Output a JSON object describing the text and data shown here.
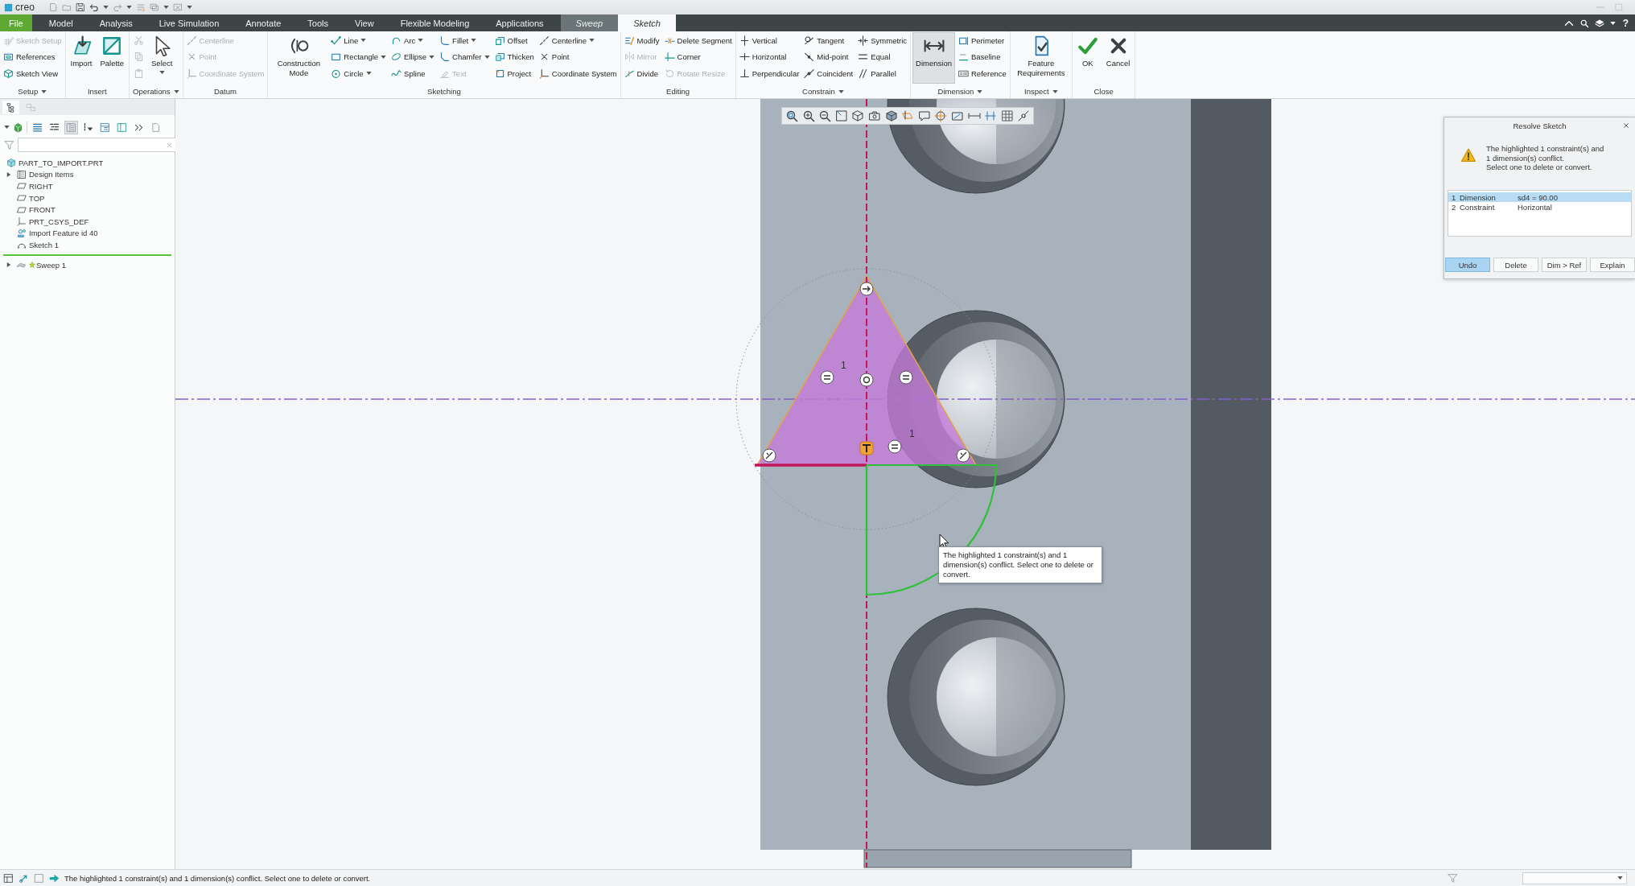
{
  "title_bar": {
    "logo": "creo"
  },
  "menu_tabs": [
    {
      "label": "File",
      "kind": "file",
      "selected": false
    },
    {
      "label": "Model",
      "kind": "main",
      "selected": false
    },
    {
      "label": "Analysis",
      "kind": "main",
      "selected": false
    },
    {
      "label": "Live Simulation",
      "kind": "main",
      "selected": false
    },
    {
      "label": "Annotate",
      "kind": "main",
      "selected": false
    },
    {
      "label": "Tools",
      "kind": "main",
      "selected": false
    },
    {
      "label": "View",
      "kind": "main",
      "selected": false
    },
    {
      "label": "Flexible Modeling",
      "kind": "main",
      "selected": false
    },
    {
      "label": "Applications",
      "kind": "main",
      "selected": false
    },
    {
      "label": "Sweep",
      "kind": "context",
      "selected": false
    },
    {
      "label": "Sketch",
      "kind": "context",
      "selected": true
    }
  ],
  "help": "?",
  "ribbon": [
    {
      "label": "Setup",
      "menu": true,
      "columns": [
        {
          "kind": "stack",
          "items": [
            {
              "label": "Sketch Setup",
              "disabled": true,
              "dropdown": false
            },
            {
              "label": "References",
              "disabled": false,
              "dropdown": false
            },
            {
              "label": "Sketch View",
              "disabled": false,
              "dropdown": false
            }
          ]
        }
      ]
    },
    {
      "label": "Insert",
      "menu": false,
      "columns": [
        {
          "kind": "large",
          "label": "Import",
          "selected": false,
          "dropdown": false
        },
        {
          "kind": "large",
          "label": "Palette",
          "selected": false,
          "dropdown": false
        }
      ]
    },
    {
      "label": "Operations",
      "menu": true,
      "columns": [
        {
          "kind": "icons",
          "items": [
            {
              "disabled": true
            },
            {
              "disabled": true
            },
            {
              "disabled": true
            }
          ]
        },
        {
          "kind": "large",
          "label": "Select",
          "selected": false,
          "dropdown": true
        }
      ]
    },
    {
      "label": "Datum",
      "menu": false,
      "columns": [
        {
          "kind": "stack",
          "items": [
            {
              "label": "Centerline",
              "disabled": true,
              "dropdown": false
            },
            {
              "label": "Point",
              "disabled": true,
              "dropdown": false
            },
            {
              "label": "Coordinate System",
              "disabled": true,
              "dropdown": false
            }
          ]
        }
      ]
    },
    {
      "label": "Sketching",
      "menu": false,
      "columns": [
        {
          "kind": "large",
          "label": "Construction Mode",
          "selected": false,
          "dropdown": false
        },
        {
          "kind": "stack",
          "items": [
            {
              "label": "Line",
              "disabled": false,
              "dropdown": true
            },
            {
              "label": "Rectangle",
              "disabled": false,
              "dropdown": true
            },
            {
              "label": "Circle",
              "disabled": false,
              "dropdown": true
            }
          ]
        },
        {
          "kind": "stack",
          "items": [
            {
              "label": "Arc",
              "disabled": false,
              "dropdown": true
            },
            {
              "label": "Ellipse",
              "disabled": false,
              "dropdown": true
            },
            {
              "label": "Spline",
              "disabled": false,
              "dropdown": false
            }
          ]
        },
        {
          "kind": "stack",
          "items": [
            {
              "label": "Fillet",
              "disabled": false,
              "dropdown": true
            },
            {
              "label": "Chamfer",
              "disabled": false,
              "dropdown": true
            },
            {
              "label": "Text",
              "disabled": true,
              "dropdown": false
            }
          ]
        },
        {
          "kind": "stack",
          "items": [
            {
              "label": "Offset",
              "disabled": false,
              "dropdown": false
            },
            {
              "label": "Thicken",
              "disabled": false,
              "dropdown": false
            },
            {
              "label": "Project",
              "disabled": false,
              "dropdown": false
            }
          ]
        },
        {
          "kind": "stack",
          "items": [
            {
              "label": "Centerline",
              "disabled": false,
              "dropdown": true
            },
            {
              "label": "Point",
              "disabled": false,
              "dropdown": false
            },
            {
              "label": "Coordinate System",
              "disabled": false,
              "dropdown": false
            }
          ]
        }
      ]
    },
    {
      "label": "Editing",
      "menu": false,
      "columns": [
        {
          "kind": "stack",
          "items": [
            {
              "label": "Modify",
              "disabled": false,
              "dropdown": false
            },
            {
              "label": "Mirror",
              "disabled": true,
              "dropdown": false
            },
            {
              "label": "Divide",
              "disabled": false,
              "dropdown": false
            }
          ]
        },
        {
          "kind": "stack",
          "items": [
            {
              "label": "Delete Segment",
              "disabled": false,
              "dropdown": false
            },
            {
              "label": "Corner",
              "disabled": false,
              "dropdown": false
            },
            {
              "label": "Rotate Resize",
              "disabled": true,
              "dropdown": false
            }
          ]
        }
      ]
    },
    {
      "label": "Constrain",
      "menu": true,
      "columns": [
        {
          "kind": "stack",
          "items": [
            {
              "label": "Vertical",
              "disabled": false,
              "dropdown": false
            },
            {
              "label": "Horizontal",
              "disabled": false,
              "dropdown": false
            },
            {
              "label": "Perpendicular",
              "disabled": false,
              "dropdown": false
            }
          ]
        },
        {
          "kind": "stack",
          "items": [
            {
              "label": "Tangent",
              "disabled": false,
              "dropdown": false
            },
            {
              "label": "Mid-point",
              "disabled": false,
              "dropdown": false
            },
            {
              "label": "Coincident",
              "disabled": false,
              "dropdown": false
            }
          ]
        },
        {
          "kind": "stack",
          "items": [
            {
              "label": "Symmetric",
              "disabled": false,
              "dropdown": false
            },
            {
              "label": "Equal",
              "disabled": false,
              "dropdown": false
            },
            {
              "label": "Parallel",
              "disabled": false,
              "dropdown": false
            }
          ]
        }
      ]
    },
    {
      "label": "Dimension",
      "menu": true,
      "columns": [
        {
          "kind": "large",
          "label": "Dimension",
          "selected": true,
          "dropdown": false
        },
        {
          "kind": "stack",
          "items": [
            {
              "label": "Perimeter",
              "disabled": false,
              "dropdown": false
            },
            {
              "label": "Baseline",
              "disabled": false,
              "dropdown": false
            },
            {
              "label": "Reference",
              "disabled": false,
              "dropdown": false
            }
          ]
        }
      ]
    },
    {
      "label": "Inspect",
      "menu": true,
      "columns": [
        {
          "kind": "large",
          "label": "Feature Requirements",
          "selected": false,
          "dropdown": false
        }
      ]
    },
    {
      "label": "Close",
      "menu": false,
      "columns": [
        {
          "kind": "large",
          "label": "OK",
          "selected": false,
          "dropdown": false
        },
        {
          "kind": "large",
          "label": "Cancel",
          "selected": false,
          "dropdown": false
        }
      ]
    }
  ],
  "model_tree": {
    "items": [
      {
        "kind": "part",
        "label": "PART_TO_IMPORT.PRT",
        "children": [
          {
            "kind": "folder",
            "label": "Design Items",
            "expanded": false
          },
          {
            "kind": "plane",
            "label": "RIGHT"
          },
          {
            "kind": "plane",
            "label": "TOP"
          },
          {
            "kind": "plane",
            "label": "FRONT"
          },
          {
            "kind": "csys",
            "label": "PRT_CSYS_DEF"
          },
          {
            "kind": "import",
            "label": "Import Feature id 40"
          },
          {
            "kind": "sketch",
            "label": "Sketch 1"
          },
          {
            "kind": "insert_here"
          },
          {
            "kind": "sweep",
            "label": "Sweep 1",
            "expanded": false
          }
        ]
      }
    ]
  },
  "sketch": {
    "constraint_labels": [
      "1",
      "1"
    ]
  },
  "tooltip": "The highlighted 1 constraint(s) and 1 dimension(s) conflict. Select one to delete or convert.",
  "resolve_dialog": {
    "title": "Resolve Sketch",
    "message": "The highlighted 1 constraint(s) and\n1 dimension(s) conflict.\nSelect one to delete or convert.",
    "conflicts": [
      {
        "number": "1",
        "type": "Dimension",
        "detail": "sd4 = 90.00",
        "selected": true
      },
      {
        "number": "2",
        "type": "Constraint",
        "detail": "Horizontal",
        "selected": false
      }
    ],
    "buttons": [
      {
        "label": "Undo",
        "focused": true
      },
      {
        "label": "Delete",
        "focused": false
      },
      {
        "label": "Dim > Ref",
        "focused": false
      },
      {
        "label": "Explain",
        "focused": false
      }
    ]
  },
  "status_bar": {
    "message": "The highlighted 1 constraint(s) and 1 dimension(s) conflict. Select one to delete or convert."
  }
}
